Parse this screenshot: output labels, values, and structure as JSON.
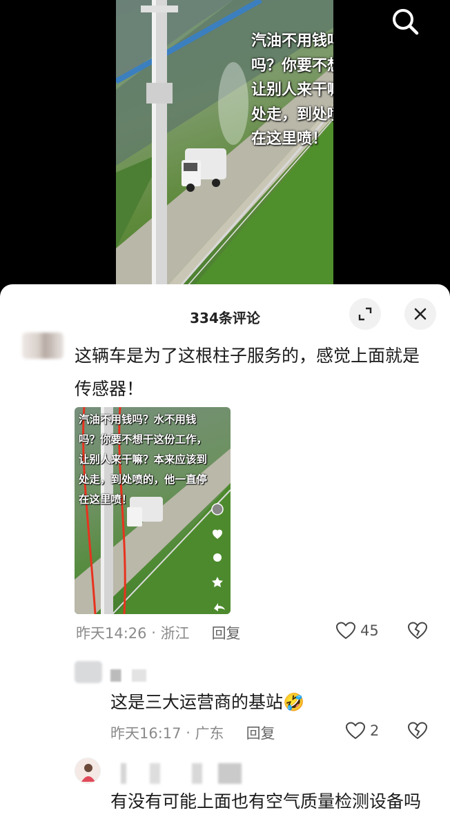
{
  "video": {
    "caption": "汽油不用钱吗？水不用钱吗？你要不想干这份工作，让别人来干嘛？本来应该到处走，到处喷的，他一直停在这里喷！"
  },
  "icons": {
    "search": "search-icon",
    "expand": "expand-icon",
    "close": "close-icon",
    "like": "heart-outline-icon",
    "dislike": "broken-heart-icon"
  },
  "sheet": {
    "title": "334条评论"
  },
  "comments": [
    {
      "text": "这辆车是为了这根柱子服务的，感觉上面就是传感器！",
      "image_caption": "汽油不用钱吗？水不用钱吗？你要不想干这份工作，让别人来干嘛？本来应该到处走，到处喷的，他一直停在这里喷！",
      "time": "昨天14:26",
      "separator": " · ",
      "location": "浙江",
      "reply_label": "回复",
      "likes": "45"
    },
    {
      "text": "这是三大运营商的基站",
      "emoji": "🤣",
      "time": "昨天16:17",
      "separator": " · ",
      "location": "广东",
      "reply_label": "回复",
      "likes": "2"
    },
    {
      "text": "有没有可能上面也有空气质量检测设备吗"
    }
  ]
}
